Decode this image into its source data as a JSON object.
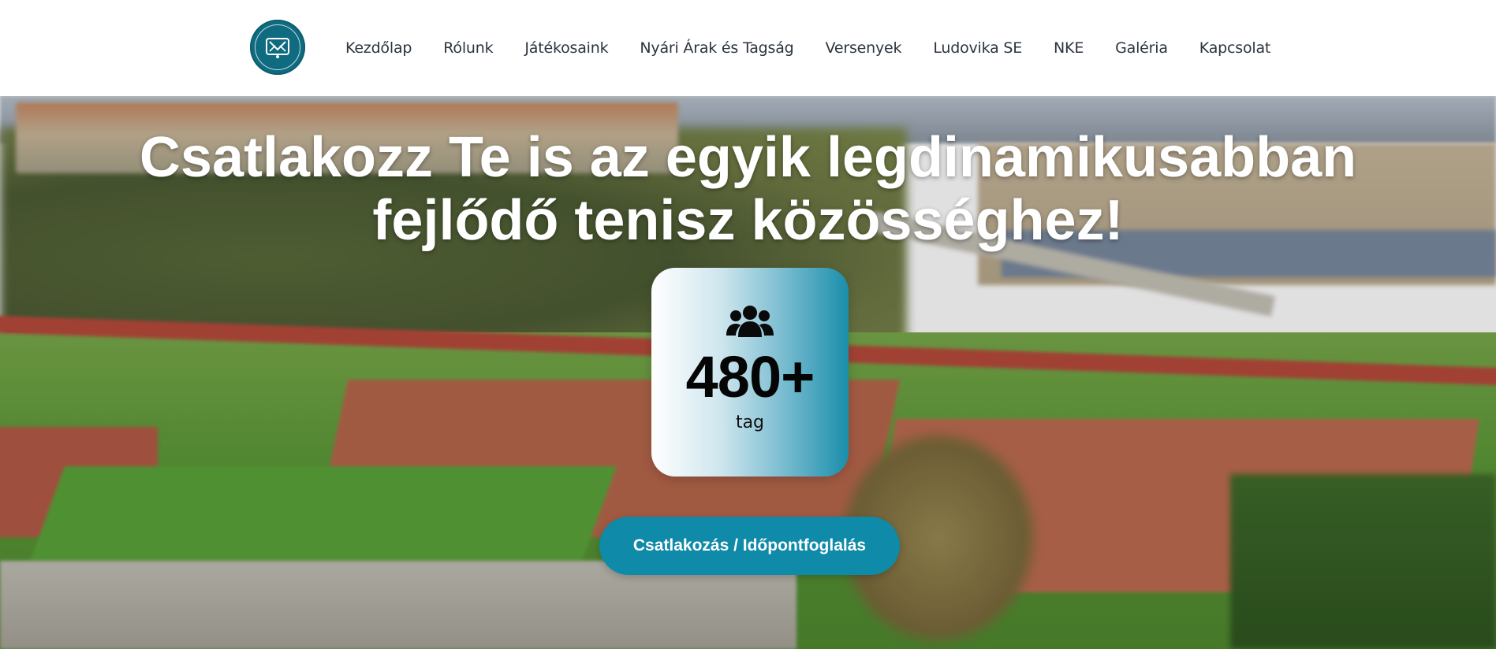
{
  "header": {
    "logo_icon": "club-crest-icon",
    "nav": [
      {
        "label": "Kezdőlap"
      },
      {
        "label": "Rólunk"
      },
      {
        "label": "Játékosaink"
      },
      {
        "label": "Nyári Árak és Tagság"
      },
      {
        "label": "Versenyek"
      },
      {
        "label": "Ludovika SE"
      },
      {
        "label": "NKE"
      },
      {
        "label": "Galéria"
      },
      {
        "label": "Kapcsolat"
      }
    ]
  },
  "hero": {
    "title_line1": "Csatlakozz Te is az egyik legdinamikusabban",
    "title_line2": "fejlődő tenisz közösséghez!",
    "stat": {
      "icon": "users-group-icon",
      "value": "480+",
      "label": "tag"
    },
    "cta_label": "Csatlakozás / Időpontfoglalás"
  },
  "colors": {
    "brand": "#0f8aa8",
    "logo_bg": "#0f6b80",
    "nav_text": "#2b3440"
  }
}
